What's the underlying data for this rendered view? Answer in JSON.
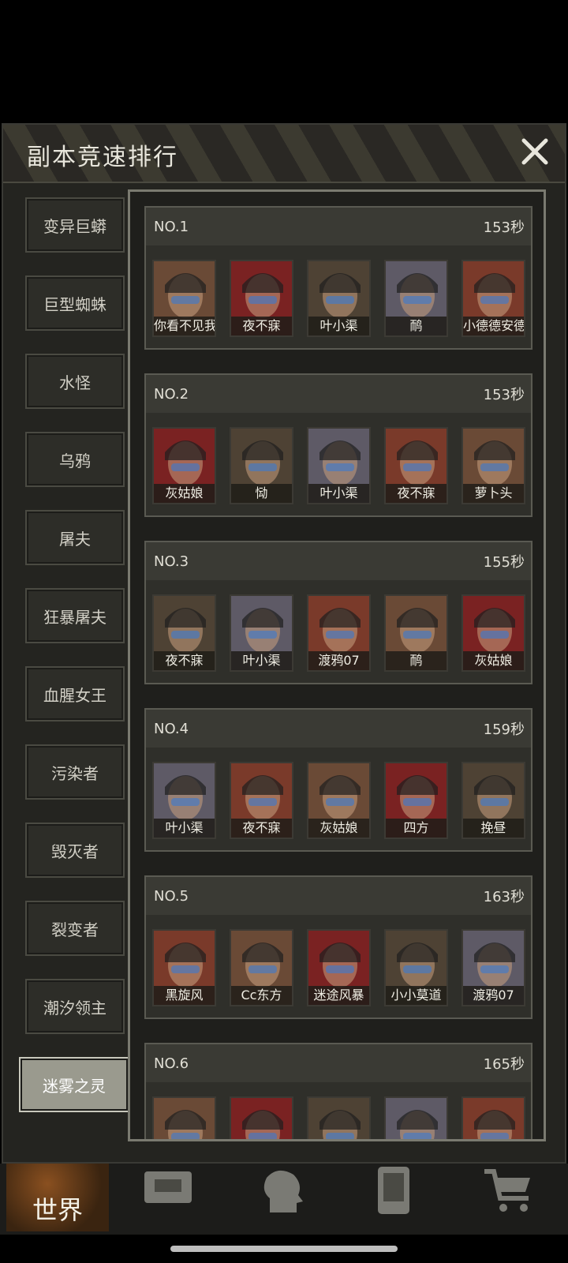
{
  "window": {
    "title": "副本竞速排行"
  },
  "tabs": [
    "变异巨蟒",
    "巨型蜘蛛",
    "水怪",
    "乌鸦",
    "屠夫",
    "狂暴屠夫",
    "血腥女王",
    "污染者",
    "毁灭者",
    "裂变者",
    "潮汐领主",
    "迷雾之灵"
  ],
  "active_tab": "迷雾之灵",
  "rankings": [
    {
      "rank": "NO.1",
      "time": "153秒",
      "members": [
        "你看不见我",
        "夜不寐",
        "叶小渠",
        "鸸",
        "小德德安德"
      ]
    },
    {
      "rank": "NO.2",
      "time": "153秒",
      "members": [
        "灰姑娘",
        "恸",
        "叶小渠",
        "夜不寐",
        "萝卜头"
      ]
    },
    {
      "rank": "NO.3",
      "time": "155秒",
      "members": [
        "夜不寐",
        "叶小渠",
        "渡鸦07",
        "鸸",
        "灰姑娘"
      ]
    },
    {
      "rank": "NO.4",
      "time": "159秒",
      "members": [
        "叶小渠",
        "夜不寐",
        "灰姑娘",
        "四方",
        "挽昼"
      ]
    },
    {
      "rank": "NO.5",
      "time": "163秒",
      "members": [
        "黑旋风",
        "Cc东方",
        "迷途风暴",
        "小小莫道",
        "渡鸦07"
      ]
    },
    {
      "rank": "NO.6",
      "time": "165秒",
      "members": [
        "",
        "",
        "",
        "",
        ""
      ]
    }
  ],
  "navbar": {
    "world_label": "世界"
  },
  "colors": {
    "panel": "#242420",
    "active_tab": "#9a9a8e",
    "entry_bg": "#2f2f2a"
  }
}
